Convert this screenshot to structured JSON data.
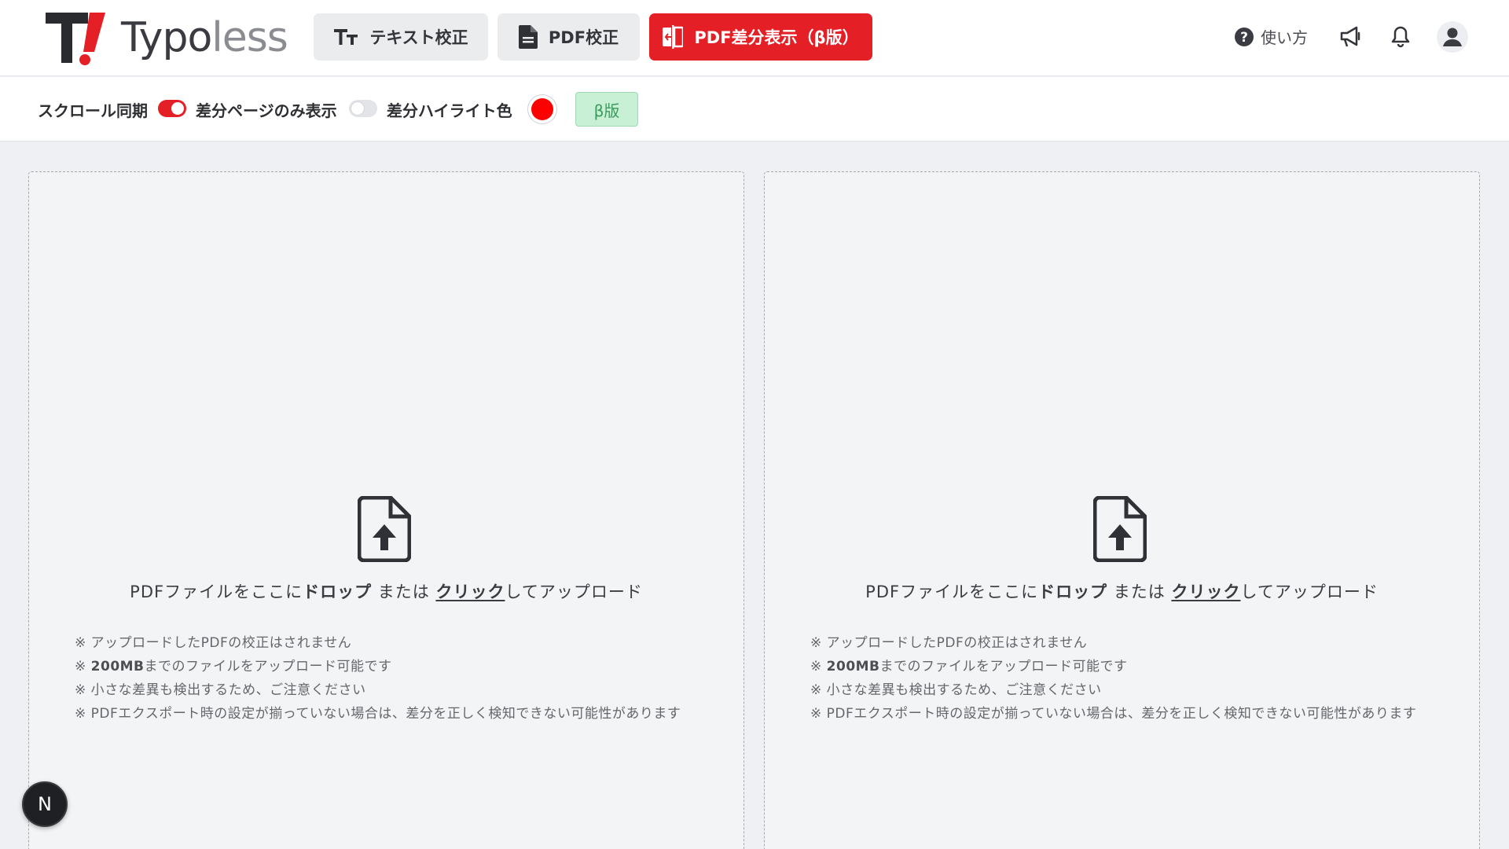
{
  "app": {
    "logo_text_main": "Typo",
    "logo_text_light": "less",
    "accent_color": "#e51f26"
  },
  "nav": {
    "text_check": {
      "label": "テキスト校正",
      "icon": "text-size-icon"
    },
    "pdf_check": {
      "label": "PDF校正",
      "icon": "file-text-icon"
    },
    "pdf_diff": {
      "label": "PDF差分表示（β版）",
      "icon": "file-compare-icon",
      "active": true
    },
    "help_label": "使い方"
  },
  "toolbar": {
    "scroll_sync_label": "スクロール同期",
    "scroll_sync_on": true,
    "diff_pages_only_label": "差分ページのみ表示",
    "diff_pages_only_on": false,
    "highlight_color_label": "差分ハイライト色",
    "highlight_color": "#ff0000",
    "beta_badge": "β版"
  },
  "dropzones": [
    {
      "main_prefix": "PDFファイルをここに",
      "drop": "ドロップ",
      "or": " または ",
      "click": "クリック",
      "main_suffix": "してアップロード",
      "notes": {
        "n1": "※ アップロードしたPDFの校正はされません",
        "n2_mark": "※ ",
        "n2_bold": "200MB",
        "n2_rest": "までのファイルをアップロード可能です",
        "n3": "※ 小さな差異も検出するため、ご注意ください",
        "n4": "※ PDFエクスポート時の設定が揃っていない場合は、差分を正しく検知できない可能性があります"
      }
    },
    {
      "main_prefix": "PDFファイルをここに",
      "drop": "ドロップ",
      "or": " または ",
      "click": "クリック",
      "main_suffix": "してアップロード",
      "notes": {
        "n1": "※ アップロードしたPDFの校正はされません",
        "n2_mark": "※ ",
        "n2_bold": "200MB",
        "n2_rest": "までのファイルをアップロード可能です",
        "n3": "※ 小さな差異も検出するため、ご注意ください",
        "n4": "※ PDFエクスポート時の設定が揃っていない場合は、差分を正しく検知できない可能性があります"
      }
    }
  ],
  "floating": {
    "badge_letter": "N"
  }
}
